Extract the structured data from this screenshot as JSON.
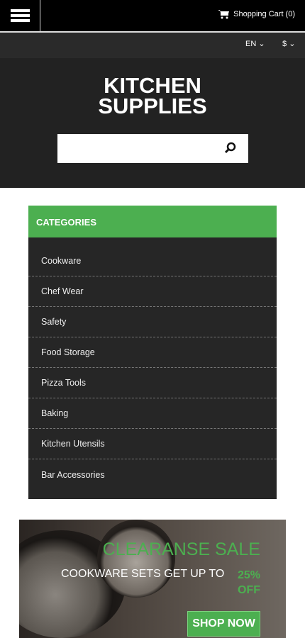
{
  "topbar": {
    "cart_label": "Shopping Cart (0)"
  },
  "selectors": {
    "language": "EN",
    "currency": "$"
  },
  "header": {
    "title_line1": "KITCHEN",
    "title_line2": "SUPPLIES",
    "search_placeholder": ""
  },
  "categories": {
    "heading": "CATEGORIES",
    "items": [
      "Cookware",
      "Chef Wear",
      "Safety",
      "Food Storage",
      "Pizza Tools",
      "Baking",
      "Kitchen Utensils",
      "Bar Accessories"
    ]
  },
  "banner": {
    "headline": "CLEARANSE SALE",
    "subline": "COOKWARE SETS GET UP TO",
    "discount_line1": "25%",
    "discount_line2": "OFF",
    "cta": "SHOP NOW"
  },
  "colors": {
    "accent": "#4caf50",
    "dark": "#222222"
  }
}
